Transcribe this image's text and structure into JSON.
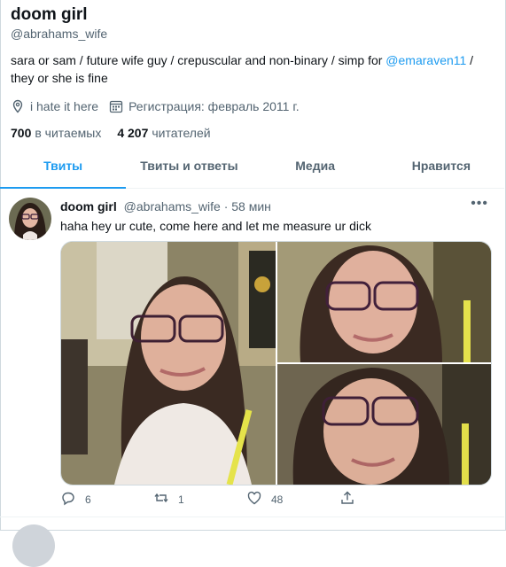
{
  "profile": {
    "name": "doom girl",
    "handle": "@abrahams_wife",
    "bio_text": "sara or sam / future wife guy / crepuscular and non-binary / simp for ",
    "bio_mention": "@emaraven11",
    "bio_after": " / they or she is fine",
    "location": "i hate it here",
    "joined": "Регистрация: февраль 2011 г.",
    "following_count": "700",
    "following_label": "в читаемых",
    "followers_count": "4 207",
    "followers_label": "читателей"
  },
  "tabs": [
    {
      "label": "Твиты",
      "active": true
    },
    {
      "label": "Твиты и ответы"
    },
    {
      "label": "Медиа"
    },
    {
      "label": "Нравится"
    }
  ],
  "tweet": {
    "author": "doom girl",
    "handle": "@abrahams_wife",
    "time": "· 58 мин",
    "text": "haha hey ur cute, come here and let me measure ur dick",
    "replies": "6",
    "retweets": "1",
    "likes": "48"
  },
  "colors": {
    "accent": "#1d9bf0",
    "muted": "#536471",
    "text": "#0f1419"
  }
}
